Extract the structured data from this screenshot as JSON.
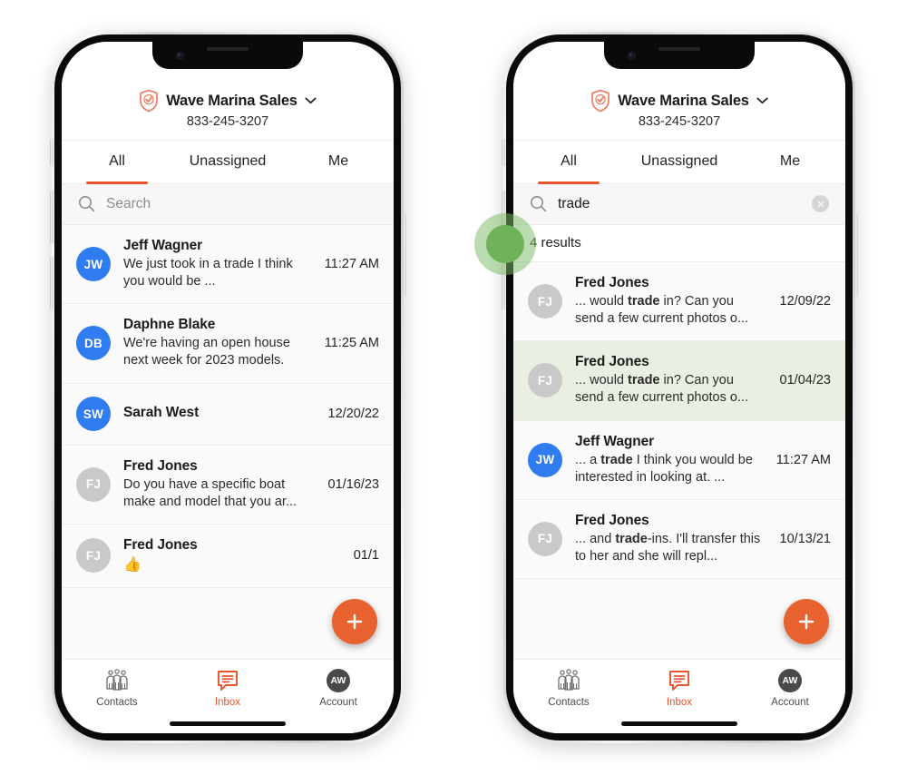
{
  "app": {
    "brand": {
      "name": "Wave Marina Sales",
      "phone": "833-245-3207",
      "logo_icon": "shield-check-icon",
      "dropdown_icon": "chevron-down-icon"
    },
    "tabs": [
      {
        "label": "All",
        "active": true
      },
      {
        "label": "Unassigned",
        "active": false
      },
      {
        "label": "Me",
        "active": false
      }
    ],
    "bottom_nav": [
      {
        "label": "Contacts",
        "icon": "people-group-icon",
        "active": false
      },
      {
        "label": "Inbox",
        "icon": "chat-bubble-icon",
        "active": true
      },
      {
        "label": "Account",
        "icon": "account-avatar-icon",
        "initials": "AW",
        "active": false
      }
    ],
    "fab": {
      "icon": "plus-icon",
      "label": "New message"
    }
  },
  "colors": {
    "accent_orange": "#e8532b",
    "fab_orange": "#e8622f",
    "avatar_blue": "#2f7cf0",
    "avatar_gray": "#c9c9c9",
    "highlight_green": "#e9f0e3",
    "touch_green": "#6fb259"
  },
  "phone_left": {
    "search": {
      "icon": "search-icon",
      "value": "",
      "placeholder": "Search",
      "show_clear": false
    },
    "results_count": "",
    "messages": [
      {
        "name": "Jeff Wagner",
        "initials": "JW",
        "avatar_color": "blue",
        "preview_pre": "We just took in a trade I think you would be ...",
        "preview_match": "",
        "preview_post": "",
        "time": "11:27 AM",
        "highlight": false,
        "emoji": ""
      },
      {
        "name": "Daphne Blake",
        "initials": "DB",
        "avatar_color": "blue",
        "preview_pre": "We're having an open house next week for 2023 models.",
        "preview_match": "",
        "preview_post": "",
        "time": "11:25 AM",
        "highlight": false,
        "emoji": ""
      },
      {
        "name": "Sarah West",
        "initials": "SW",
        "avatar_color": "blue",
        "preview_pre": "",
        "preview_match": "",
        "preview_post": "",
        "time": "12/20/22",
        "highlight": false,
        "emoji": ""
      },
      {
        "name": "Fred Jones",
        "initials": "FJ",
        "avatar_color": "gray",
        "preview_pre": "Do you have a specific boat make and model that you ar...",
        "preview_match": "",
        "preview_post": "",
        "time": "01/16/23",
        "highlight": false,
        "emoji": ""
      },
      {
        "name": "Fred Jones",
        "initials": "FJ",
        "avatar_color": "gray",
        "preview_pre": "",
        "preview_match": "",
        "preview_post": "",
        "time": "01/1",
        "highlight": false,
        "emoji": "👍"
      }
    ]
  },
  "phone_right": {
    "search": {
      "icon": "search-icon",
      "value": "trade",
      "placeholder": "Search",
      "show_clear": true,
      "clear_icon": "close-circle-icon"
    },
    "results_count": "4 results",
    "touch_indicator": {
      "name": "touch-tap-indicator"
    },
    "messages": [
      {
        "name": "Fred Jones",
        "initials": "FJ",
        "avatar_color": "gray",
        "preview_pre": "... would ",
        "preview_match": "trade",
        "preview_post": " in? Can you send a few current photos o...",
        "time": "12/09/22",
        "highlight": false,
        "emoji": ""
      },
      {
        "name": "Fred Jones",
        "initials": "FJ",
        "avatar_color": "gray",
        "preview_pre": "... would ",
        "preview_match": "trade",
        "preview_post": " in? Can you send a few current photos o...",
        "time": "01/04/23",
        "highlight": true,
        "emoji": ""
      },
      {
        "name": "Jeff Wagner",
        "initials": "JW",
        "avatar_color": "blue",
        "preview_pre": "... a ",
        "preview_match": "trade",
        "preview_post": " I think you would be interested in looking at. ...",
        "time": "11:27 AM",
        "highlight": false,
        "emoji": ""
      },
      {
        "name": "Fred Jones",
        "initials": "FJ",
        "avatar_color": "gray",
        "preview_pre": "... and ",
        "preview_match": "trade",
        "preview_post": "-ins. I'll transfer this to her and she will repl...",
        "time": "10/13/21",
        "highlight": false,
        "emoji": ""
      }
    ]
  }
}
